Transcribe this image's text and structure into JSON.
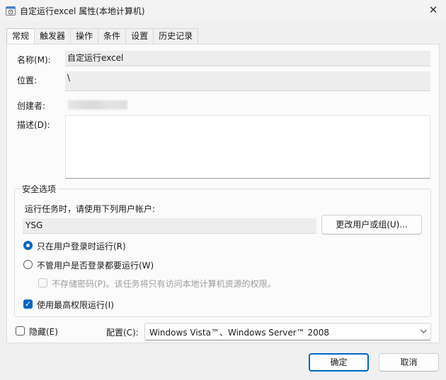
{
  "window": {
    "title": "自定运行excel 属性(本地计算机)",
    "close_glyph": "✕"
  },
  "tabs": [
    {
      "label": "常规",
      "active": true
    },
    {
      "label": "触发器"
    },
    {
      "label": "操作"
    },
    {
      "label": "条件"
    },
    {
      "label": "设置"
    },
    {
      "label": "历史记录"
    }
  ],
  "general": {
    "name_label": "名称(M):",
    "name_value": "自定运行excel",
    "location_label": "位置:",
    "location_value": "\\",
    "author_label": "创建者:",
    "description_label": "描述(D):"
  },
  "security": {
    "group_title": "安全选项",
    "run_as_label": "运行任务时，请使用下列用户帐户:",
    "account_value": "YSG",
    "change_user_button": "更改用户或组(U)...",
    "radio_logged_on": "只在用户登录时运行(R)",
    "radio_any": "不管用户是否登录都要运行(W)",
    "no_store_password": "不存储密码(P)。该任务将只有访问本地计算机资源的权限。",
    "highest_privileges": "使用最高权限运行(I)"
  },
  "footer": {
    "hidden_label": "隐藏(E)",
    "configure_label": "配置(C):",
    "configure_value": "Windows Vista™、Windows Server™ 2008",
    "ok_button": "确定",
    "cancel_button": "取消"
  },
  "icons": {
    "title_icon": "task-scheduler-icon",
    "dropdown": "chevron-down-icon"
  },
  "colors": {
    "accent": "#0067c0"
  }
}
